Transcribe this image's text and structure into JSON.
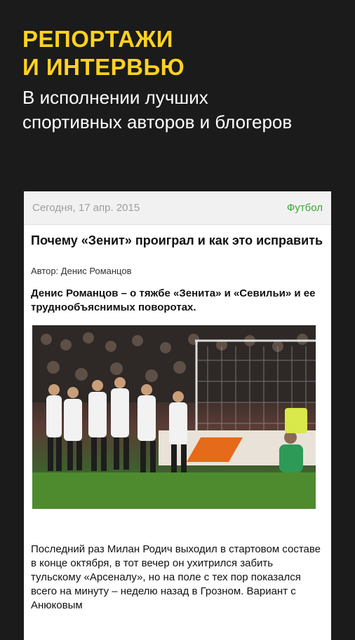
{
  "promo": {
    "title_line1": "РЕПОРТАЖИ",
    "title_line2": "И ИНТЕРВЬЮ",
    "subtitle_line1": "В исполнении лучших",
    "subtitle_line2": "спортивных авторов и блогеров"
  },
  "card": {
    "date": "Сегодня, 17 апр. 2015",
    "category": "Футбол",
    "title": "Почему «Зенит» проиграл и как это исправить",
    "author": "Автор: Денис Романцов",
    "lead": "Денис Романцов – о тяжбе «Зенита» и «Севильи» и ее труднообъяснимых поворотах.",
    "body": "Последний раз Милан Родич выходил в стартовом составе в конце октября, в тот вечер он ухитрился забить тульскому «Арсеналу», но на поле с тех пор показался всего на минуту – неделю назад в Грозном. Вариант с Анюковым"
  },
  "colors": {
    "accent": "#ffd21f",
    "category": "#3aa73a",
    "background": "#1b1b1b"
  }
}
